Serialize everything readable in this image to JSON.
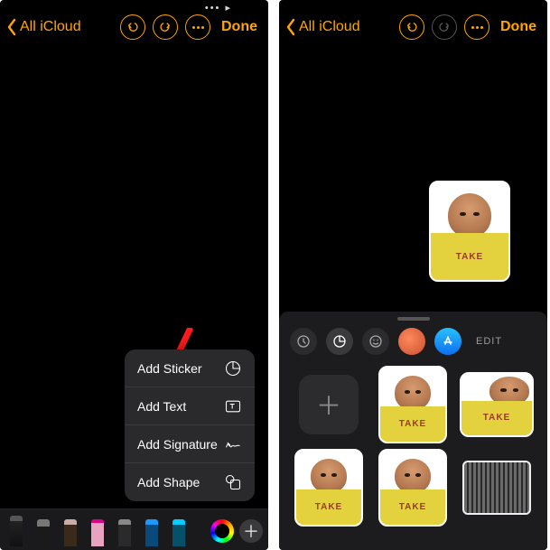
{
  "accent": "#ffa500",
  "left": {
    "statusTime": "",
    "back": "All iCloud",
    "done": "Done",
    "popup": {
      "addSticker": "Add Sticker",
      "addText": "Add Text",
      "addSignature": "Add Signature",
      "addShape": "Add Shape"
    },
    "tools": [
      "pen",
      "marker",
      "pencil",
      "eraser",
      "crayon",
      "lasso",
      "ruler"
    ]
  },
  "right": {
    "back": "All iCloud",
    "done": "Done",
    "stickerText": "TAKE",
    "panel": {
      "editLabel": "EDIT",
      "tabs": [
        "recents",
        "stickers",
        "emoji",
        "memoji",
        "apps"
      ]
    }
  }
}
